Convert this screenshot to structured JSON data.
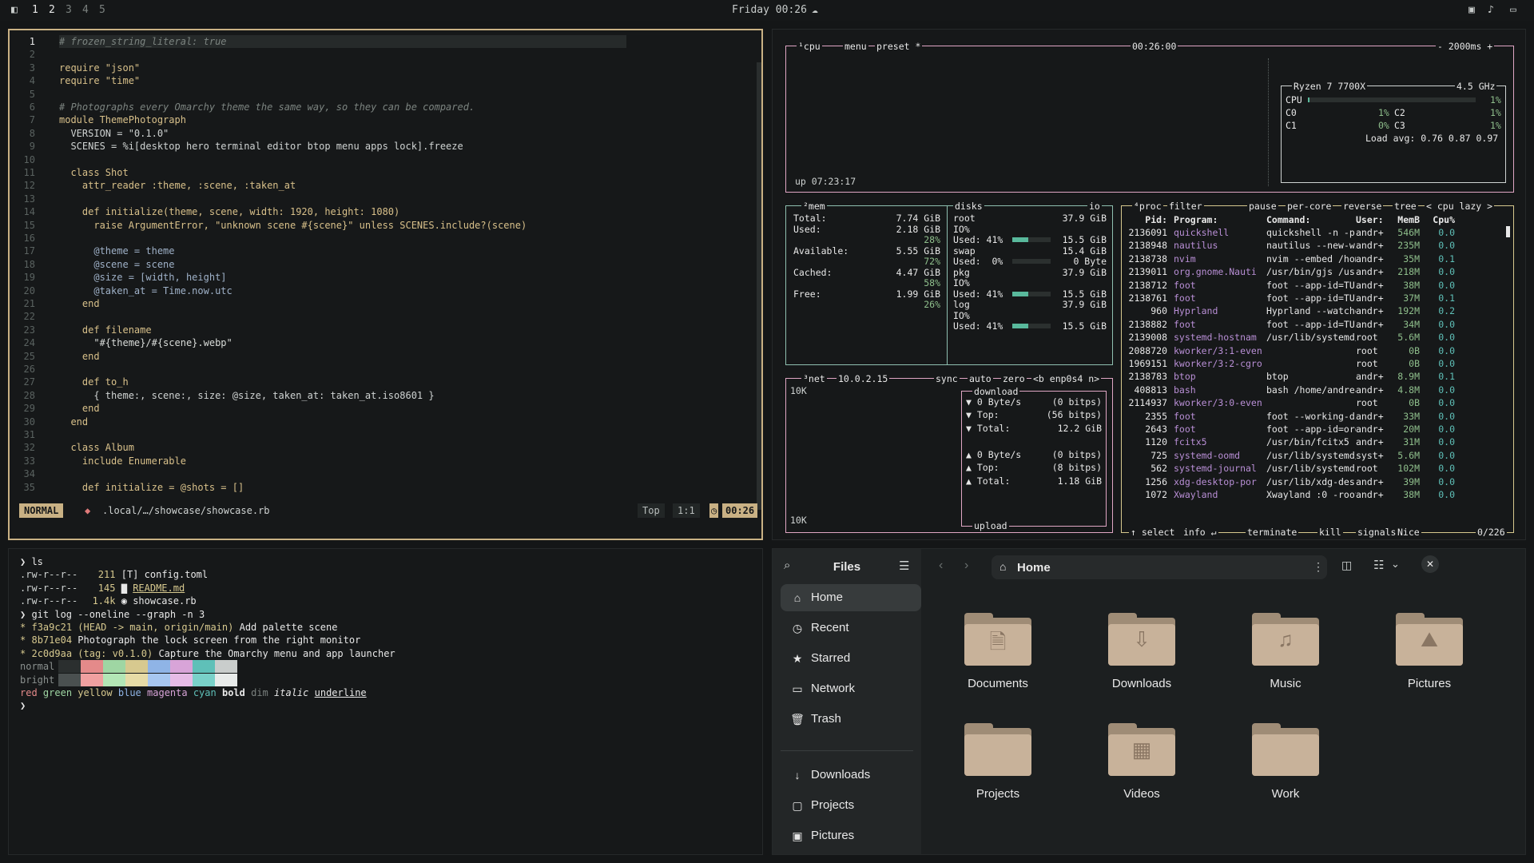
{
  "topbar": {
    "workspaces": [
      "1",
      "2",
      "3",
      "4",
      "5"
    ],
    "clock": "Friday 00:26"
  },
  "editor": {
    "lines": [
      "# frozen_string_literal: true",
      "",
      "require \"json\"",
      "require \"time\"",
      "",
      "# Photographs every Omarchy theme the same way, so they can be compared.",
      "module ThemePhotograph",
      "  VERSION = \"0.1.0\"",
      "  SCENES = %i[desktop hero terminal editor btop menu apps lock].freeze",
      "",
      "  class Shot",
      "    attr_reader :theme, :scene, :taken_at",
      "",
      "    def initialize(theme, scene, width: 1920, height: 1080)",
      "      raise ArgumentError, \"unknown scene #{scene}\" unless SCENES.include?(scene)",
      "",
      "      @theme = theme",
      "      @scene = scene",
      "      @size = [width, height]",
      "      @taken_at = Time.now.utc",
      "    end",
      "",
      "    def filename",
      "      \"#{theme}/#{scene}.webp\"",
      "    end",
      "",
      "    def to_h",
      "      { theme:, scene:, size: @size, taken_at: taken_at.iso8601 }",
      "    end",
      "  end",
      "",
      "  class Album",
      "    include Enumerable",
      "",
      "    def initialize = @shots = []"
    ],
    "line_numbers": [
      "1",
      "2",
      "3",
      "4",
      "5",
      "6",
      "7",
      "8",
      "9",
      "10",
      "11",
      "12",
      "13",
      "14",
      "15",
      "16",
      "17",
      "18",
      "19",
      "20",
      "21",
      "22",
      "23",
      "24",
      "25",
      "26",
      "27",
      "28",
      "29",
      "30",
      "31",
      "32",
      "33",
      "34",
      "35"
    ],
    "status": {
      "mode": "NORMAL",
      "path": ".local/…/showcase/showcase.rb",
      "position": "Top",
      "cursor": "1:1",
      "time": "00:26"
    }
  },
  "btop": {
    "cpu": {
      "header_tabs": [
        "¹cpu",
        "menu",
        "preset *"
      ],
      "clock": "00:26:00",
      "interval": "- 2000ms +",
      "uptime": "up 07:23:17",
      "model": "Ryzen 7 7700X",
      "freq": "4.5 GHz",
      "cpu_label": "CPU",
      "cpu_pct": "1%",
      "cores": [
        {
          "name": "C0",
          "pct": "1%"
        },
        {
          "name": "C1",
          "pct": "0%"
        },
        {
          "name": "C2",
          "pct": "1%"
        },
        {
          "name": "C3",
          "pct": "1%"
        }
      ],
      "load_avg": "Load avg: 0.76 0.87 0.97"
    },
    "mem": {
      "title": "²mem",
      "rows": [
        {
          "label": "Total:",
          "value": "7.74 GiB"
        },
        {
          "label": "Used:",
          "value": "2.18 GiB",
          "pct": "28%"
        },
        {
          "label": "Available:",
          "value": "5.55 GiB",
          "pct": "72%"
        },
        {
          "label": "Cached:",
          "value": "4.47 GiB",
          "pct": "58%"
        },
        {
          "label": "Free:",
          "value": "1.99 GiB",
          "pct": "26%"
        }
      ]
    },
    "disks": {
      "title": "disks",
      "io_label": "io",
      "items": [
        {
          "name": "root",
          "size": "37.9 GiB",
          "io": "IO%",
          "used": "Used: 41%",
          "used_val": "15.5 GiB",
          "used_frac": 0.41
        },
        {
          "name": "swap",
          "size": "15.4 GiB",
          "io": "",
          "used": "Used:  0%",
          "used_val": "0 Byte",
          "used_frac": 0.0
        },
        {
          "name": "pkg",
          "size": "37.9 GiB",
          "io": "IO%",
          "used": "Used: 41%",
          "used_val": "15.5 GiB",
          "used_frac": 0.41
        },
        {
          "name": "log",
          "size": "37.9 GiB",
          "io": "IO%",
          "used": "Used: 41%",
          "used_val": "15.5 GiB",
          "used_frac": 0.41
        }
      ]
    },
    "net": {
      "title": "³net",
      "ip": "10.0.2.15",
      "tabs": [
        "sync",
        "auto",
        "zero",
        "<b enp0s4 n>"
      ],
      "scale_top": "10K",
      "scale_bottom": "10K",
      "download_label": "download",
      "upload_label": "upload",
      "download": [
        {
          "k": "▼ 0 Byte/s",
          "v": "(0 bitps)"
        },
        {
          "k": "▼ Top:",
          "v": "(56 bitps)"
        },
        {
          "k": "▼ Total:",
          "v": "12.2 GiB"
        }
      ],
      "upload": [
        {
          "k": "▲ 0 Byte/s",
          "v": "(0 bitps)"
        },
        {
          "k": "▲ Top:",
          "v": "(8 bitps)"
        },
        {
          "k": "▲ Total:",
          "v": "1.18 GiB"
        }
      ]
    },
    "proc": {
      "tabs": [
        "⁴proc",
        "filter",
        "pause",
        "per-core",
        "reverse",
        "tree",
        "< cpu lazy >"
      ],
      "columns": [
        "Pid:",
        "Program:",
        "Command:",
        "User:",
        "MemB",
        "Cpu%"
      ],
      "rows": [
        [
          "2136091",
          "quickshell",
          "quickshell -n -p /",
          "andr+",
          "546M",
          "0.0"
        ],
        [
          "2138948",
          "nautilus",
          "nautilus --new-win",
          "andr+",
          "235M",
          "0.0"
        ],
        [
          "2138738",
          "nvim",
          "nvim --embed /home",
          "andr+",
          "35M",
          "0.1"
        ],
        [
          "2139011",
          "org.gnome.Nauti",
          "/usr/bin/gjs /usr/",
          "andr+",
          "218M",
          "0.0"
        ],
        [
          "2138712",
          "foot",
          "foot --app-id=TUI.",
          "andr+",
          "38M",
          "0.0"
        ],
        [
          "2138761",
          "foot",
          "foot --app-id=TUI.",
          "andr+",
          "37M",
          "0.1"
        ],
        [
          "960",
          "Hyprland",
          "Hyprland --watchdo",
          "andr+",
          "192M",
          "0.2"
        ],
        [
          "2138882",
          "foot",
          "foot --app-id=TUI.",
          "andr+",
          "34M",
          "0.0"
        ],
        [
          "2139008",
          "systemd-hostnam",
          "/usr/lib/systemd/s",
          "root",
          "5.6M",
          "0.0"
        ],
        [
          "2088720",
          "kworker/3:1-even",
          "",
          "root",
          "0B",
          "0.0"
        ],
        [
          "1969151",
          "kworker/3:2-cgro",
          "",
          "root",
          "0B",
          "0.0"
        ],
        [
          "2138783",
          "btop",
          "btop",
          "andr+",
          "8.9M",
          "0.1"
        ],
        [
          "408813",
          "bash",
          "bash /home/andreas",
          "andr+",
          "4.8M",
          "0.0"
        ],
        [
          "2114937",
          "kworker/3:0-even",
          "",
          "root",
          "0B",
          "0.0"
        ],
        [
          "2355",
          "foot",
          "foot --working-dir",
          "andr+",
          "33M",
          "0.0"
        ],
        [
          "2643",
          "foot",
          "foot --app-id=org.",
          "andr+",
          "20M",
          "0.0"
        ],
        [
          "1120",
          "fcitx5",
          "/usr/bin/fcitx5 --",
          "andr+",
          "31M",
          "0.0"
        ],
        [
          "725",
          "systemd-oomd",
          "/usr/lib/systemd/s",
          "syst+",
          "5.6M",
          "0.0"
        ],
        [
          "562",
          "systemd-journal",
          "/usr/lib/systemd/s",
          "root",
          "102M",
          "0.0"
        ],
        [
          "1256",
          "xdg-desktop-por",
          "/usr/lib/xdg-deskt",
          "andr+",
          "39M",
          "0.0"
        ],
        [
          "1072",
          "Xwayland",
          "Xwayland :0 -rootl",
          "andr+",
          "38M",
          "0.0"
        ]
      ],
      "footer": [
        "↑ select ↓",
        "info ↵",
        "terminate",
        "kill",
        "signals",
        "Nice"
      ],
      "count": "0/226"
    }
  },
  "terminal": {
    "prompt1": "❯ ls",
    "files": [
      {
        "perm": ".rw-r--r--",
        "size": "211",
        "icon": "[T]",
        "name": "config.toml"
      },
      {
        "perm": ".rw-r--r--",
        "size": "145",
        "icon": "▇",
        "name": "README.md"
      },
      {
        "perm": ".rw-r--r--",
        "size": "1.4k",
        "icon": "◉",
        "name": "showcase.rb"
      }
    ],
    "prompt2": "❯ git log --oneline --graph -n 3",
    "commits": [
      {
        "hash": "f3a9c21",
        "refs": "(HEAD -> main, origin/main)",
        "msg": "Add palette scene"
      },
      {
        "hash": "8b71e04",
        "refs": "",
        "msg": "Photograph the lock screen from the right monitor"
      },
      {
        "hash": "2c0d9aa",
        "refs": "(tag: v0.1.0)",
        "msg": "Capture the Omarchy menu and app launcher"
      }
    ],
    "palette_normal_label": "normal",
    "palette_bright_label": "bright",
    "palette_normal": [
      "#2b2f2f",
      "#e48a8a",
      "#9fd6a3",
      "#d7c98f",
      "#8fb4e6",
      "#d8a4d8",
      "#5fc0b8",
      "#c9cdcc"
    ],
    "palette_bright": [
      "#4a5050",
      "#f0a0a0",
      "#b3e6b6",
      "#e6dba6",
      "#a7c7f0",
      "#e6bbe6",
      "#79d1c9",
      "#e8ebea"
    ],
    "styles": [
      "red",
      "green",
      "yellow",
      "blue",
      "magenta",
      "cyan",
      "bold",
      "dim",
      "italic",
      "underline"
    ],
    "prompt3": "❯"
  },
  "files_app": {
    "title": "Files",
    "location": "Home",
    "sidebar": [
      {
        "label": "Home",
        "icon": "home-icon"
      },
      {
        "label": "Recent",
        "icon": "recent-icon"
      },
      {
        "label": "Starred",
        "icon": "star-icon"
      },
      {
        "label": "Network",
        "icon": "network-icon"
      },
      {
        "label": "Trash",
        "icon": "trash-icon"
      },
      {
        "label": "Downloads",
        "icon": "download-icon"
      },
      {
        "label": "Projects",
        "icon": "folder-icon"
      },
      {
        "label": "Pictures",
        "icon": "picture-icon"
      }
    ],
    "folders": [
      {
        "label": "Documents",
        "glyph": "🗎"
      },
      {
        "label": "Downloads",
        "glyph": "⇩"
      },
      {
        "label": "Music",
        "glyph": "♫"
      },
      {
        "label": "Pictures",
        "glyph": "⛰"
      },
      {
        "label": "Projects",
        "glyph": ""
      },
      {
        "label": "Videos",
        "glyph": "▦"
      },
      {
        "label": "Work",
        "glyph": ""
      }
    ]
  }
}
